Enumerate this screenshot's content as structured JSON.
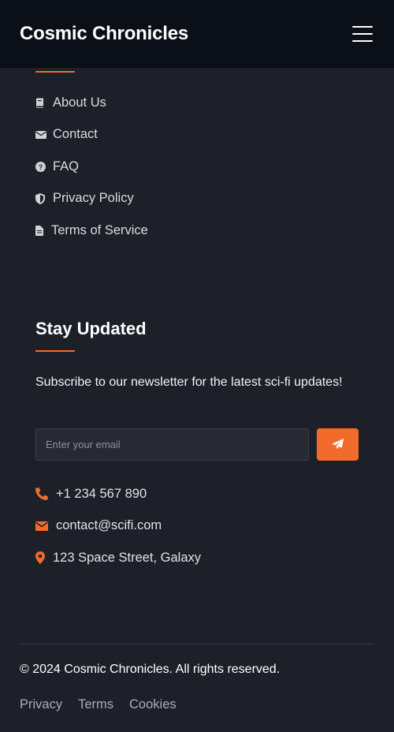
{
  "header": {
    "title": "Cosmic Chronicles",
    "menu_icon": "hamburger-icon"
  },
  "quick_links": [
    {
      "label": "About Us",
      "icon": "book-icon"
    },
    {
      "label": "Contact",
      "icon": "envelope-icon"
    },
    {
      "label": "FAQ",
      "icon": "question-circle-icon"
    },
    {
      "label": "Privacy Policy",
      "icon": "shield-icon"
    },
    {
      "label": "Terms of Service",
      "icon": "file-icon"
    }
  ],
  "newsletter": {
    "title": "Stay Updated",
    "description": "Subscribe to our newsletter for the latest sci-fi updates!",
    "email_placeholder": "Enter your email",
    "submit_icon": "paper-plane-icon"
  },
  "contact": {
    "phone": "+1 234 567 890",
    "email": "contact@scifi.com",
    "address": "123 Space Street, Galaxy"
  },
  "footer": {
    "copyright": "© 2024 Cosmic Chronicles. All rights reserved.",
    "links": [
      "Privacy",
      "Terms",
      "Cookies"
    ]
  },
  "colors": {
    "accent": "#f26b2a",
    "header_bg": "#0b0f17",
    "page_bg": "#1d2029"
  }
}
